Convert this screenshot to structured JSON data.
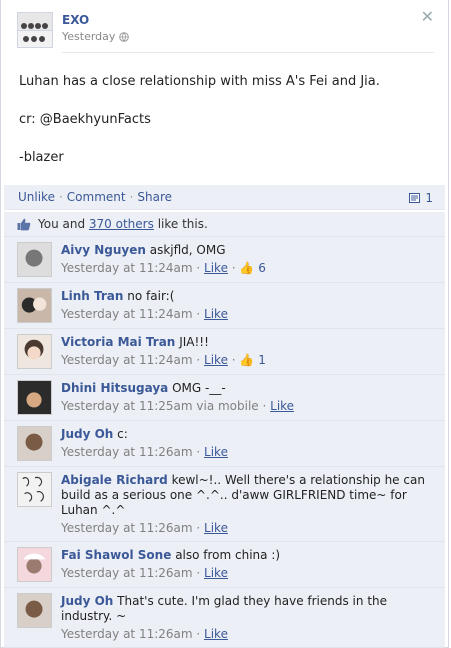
{
  "post": {
    "author": "EXO",
    "time": "Yesterday",
    "lines": [
      "Luhan has a close relationship with miss A's Fei and Jia.",
      "cr: @BaekhyunFacts",
      "-blazer"
    ]
  },
  "actions": {
    "unlike": "Unlike",
    "comment": "Comment",
    "share": "Share",
    "share_count": "1"
  },
  "likes": {
    "prefix": "You and",
    "others_link": "370 others",
    "suffix": "like this."
  },
  "comments": [
    {
      "name": "Aivy Nguyen",
      "text": "askjfld, OMG",
      "time": "Yesterday at 11:24am",
      "like_label": "Like",
      "like_count": "6",
      "colors": [
        "#ddd",
        "#777"
      ]
    },
    {
      "name": "Linh Tran",
      "text": "no fair:(",
      "time": "Yesterday at 11:24am",
      "like_label": "Like",
      "like_count": "",
      "colors": [
        "#c9b8aa",
        "#2a2a2a"
      ]
    },
    {
      "name": "Victoria Mai Tran",
      "text": "JIA!!!",
      "time": "Yesterday at 11:24am",
      "like_label": "Like",
      "like_count": "1",
      "colors": [
        "#f0e6e0",
        "#4a3a30"
      ]
    },
    {
      "name": "Dhini Hitsugaya",
      "text": "OMG -__-",
      "time": "Yesterday at 11:25am via mobile",
      "like_label": "Like",
      "like_count": "",
      "colors": [
        "#2b2b2b",
        "#d6a983"
      ]
    },
    {
      "name": "Judy Oh",
      "text": "c:",
      "time": "Yesterday at 11:26am",
      "like_label": "Like",
      "like_count": "",
      "colors": [
        "#d8d0c8",
        "#7a5b45"
      ]
    },
    {
      "name": "Abigale Richard",
      "text": "kewl~!.. Well there's a relationship he can build as a serious one ^.^.. d'aww GIRLFRIEND time~ for Luhan ^.^",
      "time": "Yesterday at 11:26am",
      "like_label": "Like",
      "like_count": "",
      "colors": [
        "#f2f2f2",
        "#333"
      ]
    },
    {
      "name": "Fai Shawol Sone",
      "text": "also from china :)",
      "time": "Yesterday at 11:26am",
      "like_label": "Like",
      "like_count": "",
      "colors": [
        "#f4d8de",
        "#9b7a70"
      ]
    },
    {
      "name": "Judy Oh",
      "text": "That's cute. I'm glad they have friends in the industry. ~",
      "time": "Yesterday at 11:26am",
      "like_label": "Like",
      "like_count": "",
      "colors": [
        "#d8d0c8",
        "#7a5b45"
      ]
    }
  ],
  "icons": {
    "close": "close-icon",
    "globe": "globe-icon",
    "thumb": "thumbs-up-icon",
    "share": "share-icon",
    "like_small": "like-hand-icon"
  },
  "colors": {
    "link": "#3b5998",
    "meta": "#808080",
    "comment_bg": "#eceff5"
  }
}
